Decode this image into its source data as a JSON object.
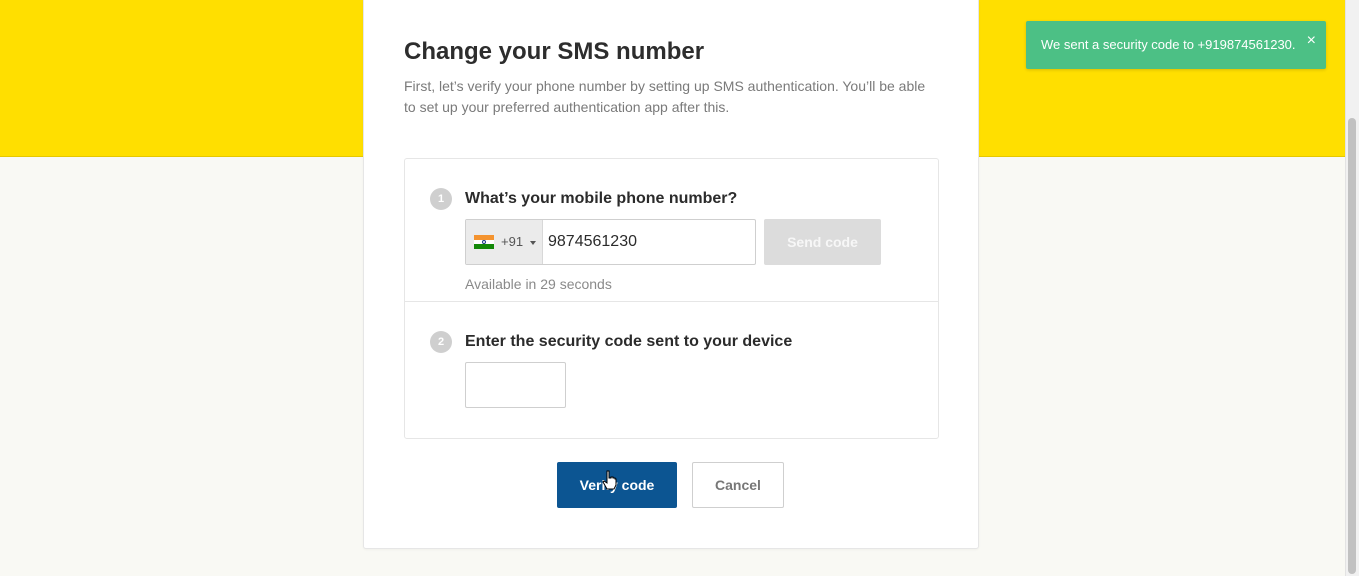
{
  "page": {
    "title": "Change your SMS number",
    "intro": "First, let’s verify your phone number by setting up SMS authentication. You’ll be able to set up your preferred authentication app after this."
  },
  "step1": {
    "number": "1",
    "title": "What’s your mobile phone number?",
    "country_code": "+91",
    "country_flag": "india-flag",
    "phone_value": "9874561230",
    "send_label": "Send code",
    "send_enabled": false,
    "availability": "Available in 29 seconds"
  },
  "step2": {
    "number": "2",
    "title": "Enter the security code sent to your device",
    "code_value": ""
  },
  "actions": {
    "verify_label": "Verify code",
    "cancel_label": "Cancel"
  },
  "toast": {
    "message": "We sent a security code to +919874561230.",
    "close_glyph": "×"
  },
  "colors": {
    "banner": "#ffdf00",
    "primary": "#0c5592",
    "toast": "#4cc085",
    "disabled": "#dcdcdc"
  }
}
